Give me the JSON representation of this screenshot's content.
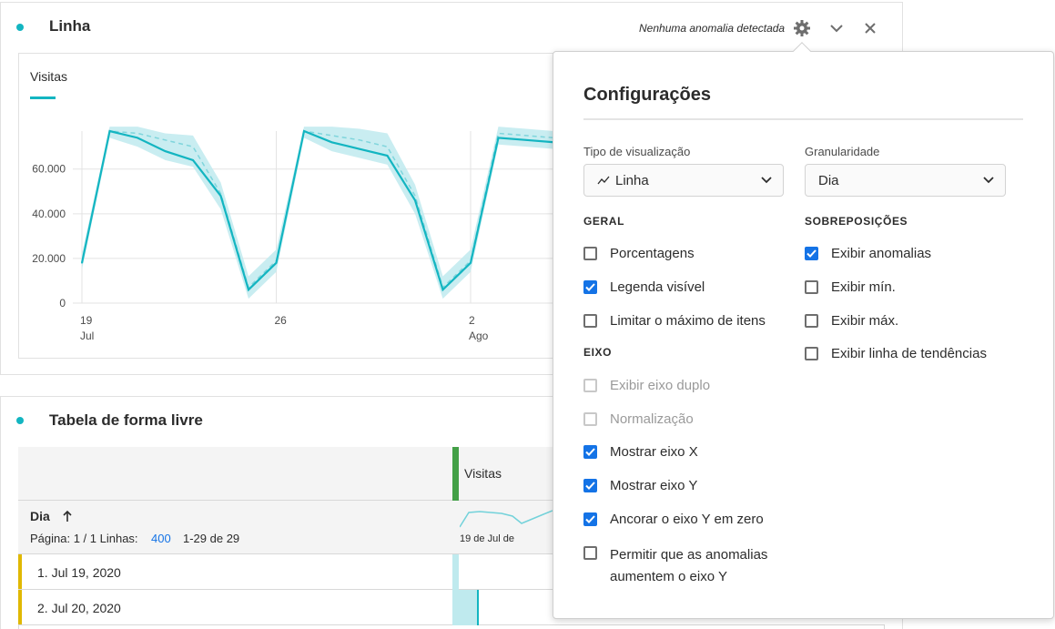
{
  "line_panel": {
    "title": "Linha",
    "anomaly_status": "Nenhuma anomalia detectada",
    "legend_label": "Visitas"
  },
  "chart_data": {
    "type": "line",
    "title": "",
    "series": [
      {
        "name": "Visitas",
        "values": [
          18000,
          77000,
          74000,
          68000,
          64000,
          48000,
          6000,
          18000,
          77000,
          72000,
          69000,
          66000,
          46000,
          6000,
          18000,
          74000,
          73000,
          72000
        ]
      }
    ],
    "expected_band_upper": [
      22000,
      79000,
      79000,
      76000,
      75000,
      54000,
      12000,
      24000,
      79000,
      79000,
      78000,
      76000,
      53000,
      12000,
      24000,
      79000,
      78000,
      77000
    ],
    "expected_band_lower": [
      15000,
      74000,
      70000,
      64000,
      61000,
      42000,
      2000,
      14000,
      74000,
      68000,
      65000,
      62000,
      40000,
      2000,
      14000,
      71000,
      70000,
      69000
    ],
    "expected_line": [
      18000,
      77000,
      76000,
      73000,
      70000,
      49000,
      7000,
      19000,
      77000,
      75000,
      73000,
      70000,
      48000,
      7000,
      19000,
      76000,
      75000,
      74000
    ],
    "yticks": [
      "0",
      "20.000",
      "40.000",
      "60.000"
    ],
    "ytick_values": [
      0,
      20000,
      40000,
      60000
    ],
    "ylim": [
      0,
      77000
    ],
    "xticks": [
      {
        "day": "19",
        "month": "Jul",
        "index": 0
      },
      {
        "day": "26",
        "month": "",
        "index": 7
      },
      {
        "day": "2",
        "month": "Ago",
        "index": 14
      }
    ],
    "grid": true,
    "color": "#13b5c1",
    "band_color": "#bfeaee"
  },
  "table_panel": {
    "title": "Tabela de forma livre",
    "column_header": "Visitas",
    "dimension": "Dia",
    "sort_icon": "arrow-up-icon",
    "page_info": "Página: 1 / 1 Linhas:",
    "rows_count": "400",
    "range": "1-29 de 29",
    "sparkline_caption": "19 de Jul de",
    "rows": [
      {
        "label": "1. Jul 19, 2020"
      },
      {
        "label": "2. Jul 20, 2020"
      }
    ]
  },
  "settings": {
    "title": "Configurações",
    "viz_type_label": "Tipo de visualização",
    "viz_type_value": "Linha",
    "granularity_label": "Granularidade",
    "granularity_value": "Dia",
    "general_heading": "GERAL",
    "overlays_heading": "SOBREPOSIÇÕES",
    "axis_heading": "EIXO",
    "general": [
      {
        "label": "Porcentagens",
        "checked": false
      },
      {
        "label": "Legenda visível",
        "checked": true
      },
      {
        "label": "Limitar o máximo de itens",
        "checked": false
      }
    ],
    "overlays": [
      {
        "label": "Exibir anomalias",
        "checked": true
      },
      {
        "label": "Exibir mín.",
        "checked": false
      },
      {
        "label": "Exibir máx.",
        "checked": false
      },
      {
        "label": "Exibir linha de tendências",
        "checked": false
      }
    ],
    "axis": [
      {
        "label": "Exibir eixo duplo",
        "checked": false,
        "disabled": true
      },
      {
        "label": "Normalização",
        "checked": false,
        "disabled": true
      },
      {
        "label": "Mostrar eixo X",
        "checked": true
      },
      {
        "label": "Mostrar eixo Y",
        "checked": true
      },
      {
        "label": "Ancorar o eixo Y em zero",
        "checked": true
      },
      {
        "label": "Permitir que as anomalias aumentem o eixo Y",
        "line1": "Permitir que as anomalias",
        "line2": "aumentem o eixo Y",
        "checked": false
      }
    ],
    "accent_color": "#1473e6"
  }
}
